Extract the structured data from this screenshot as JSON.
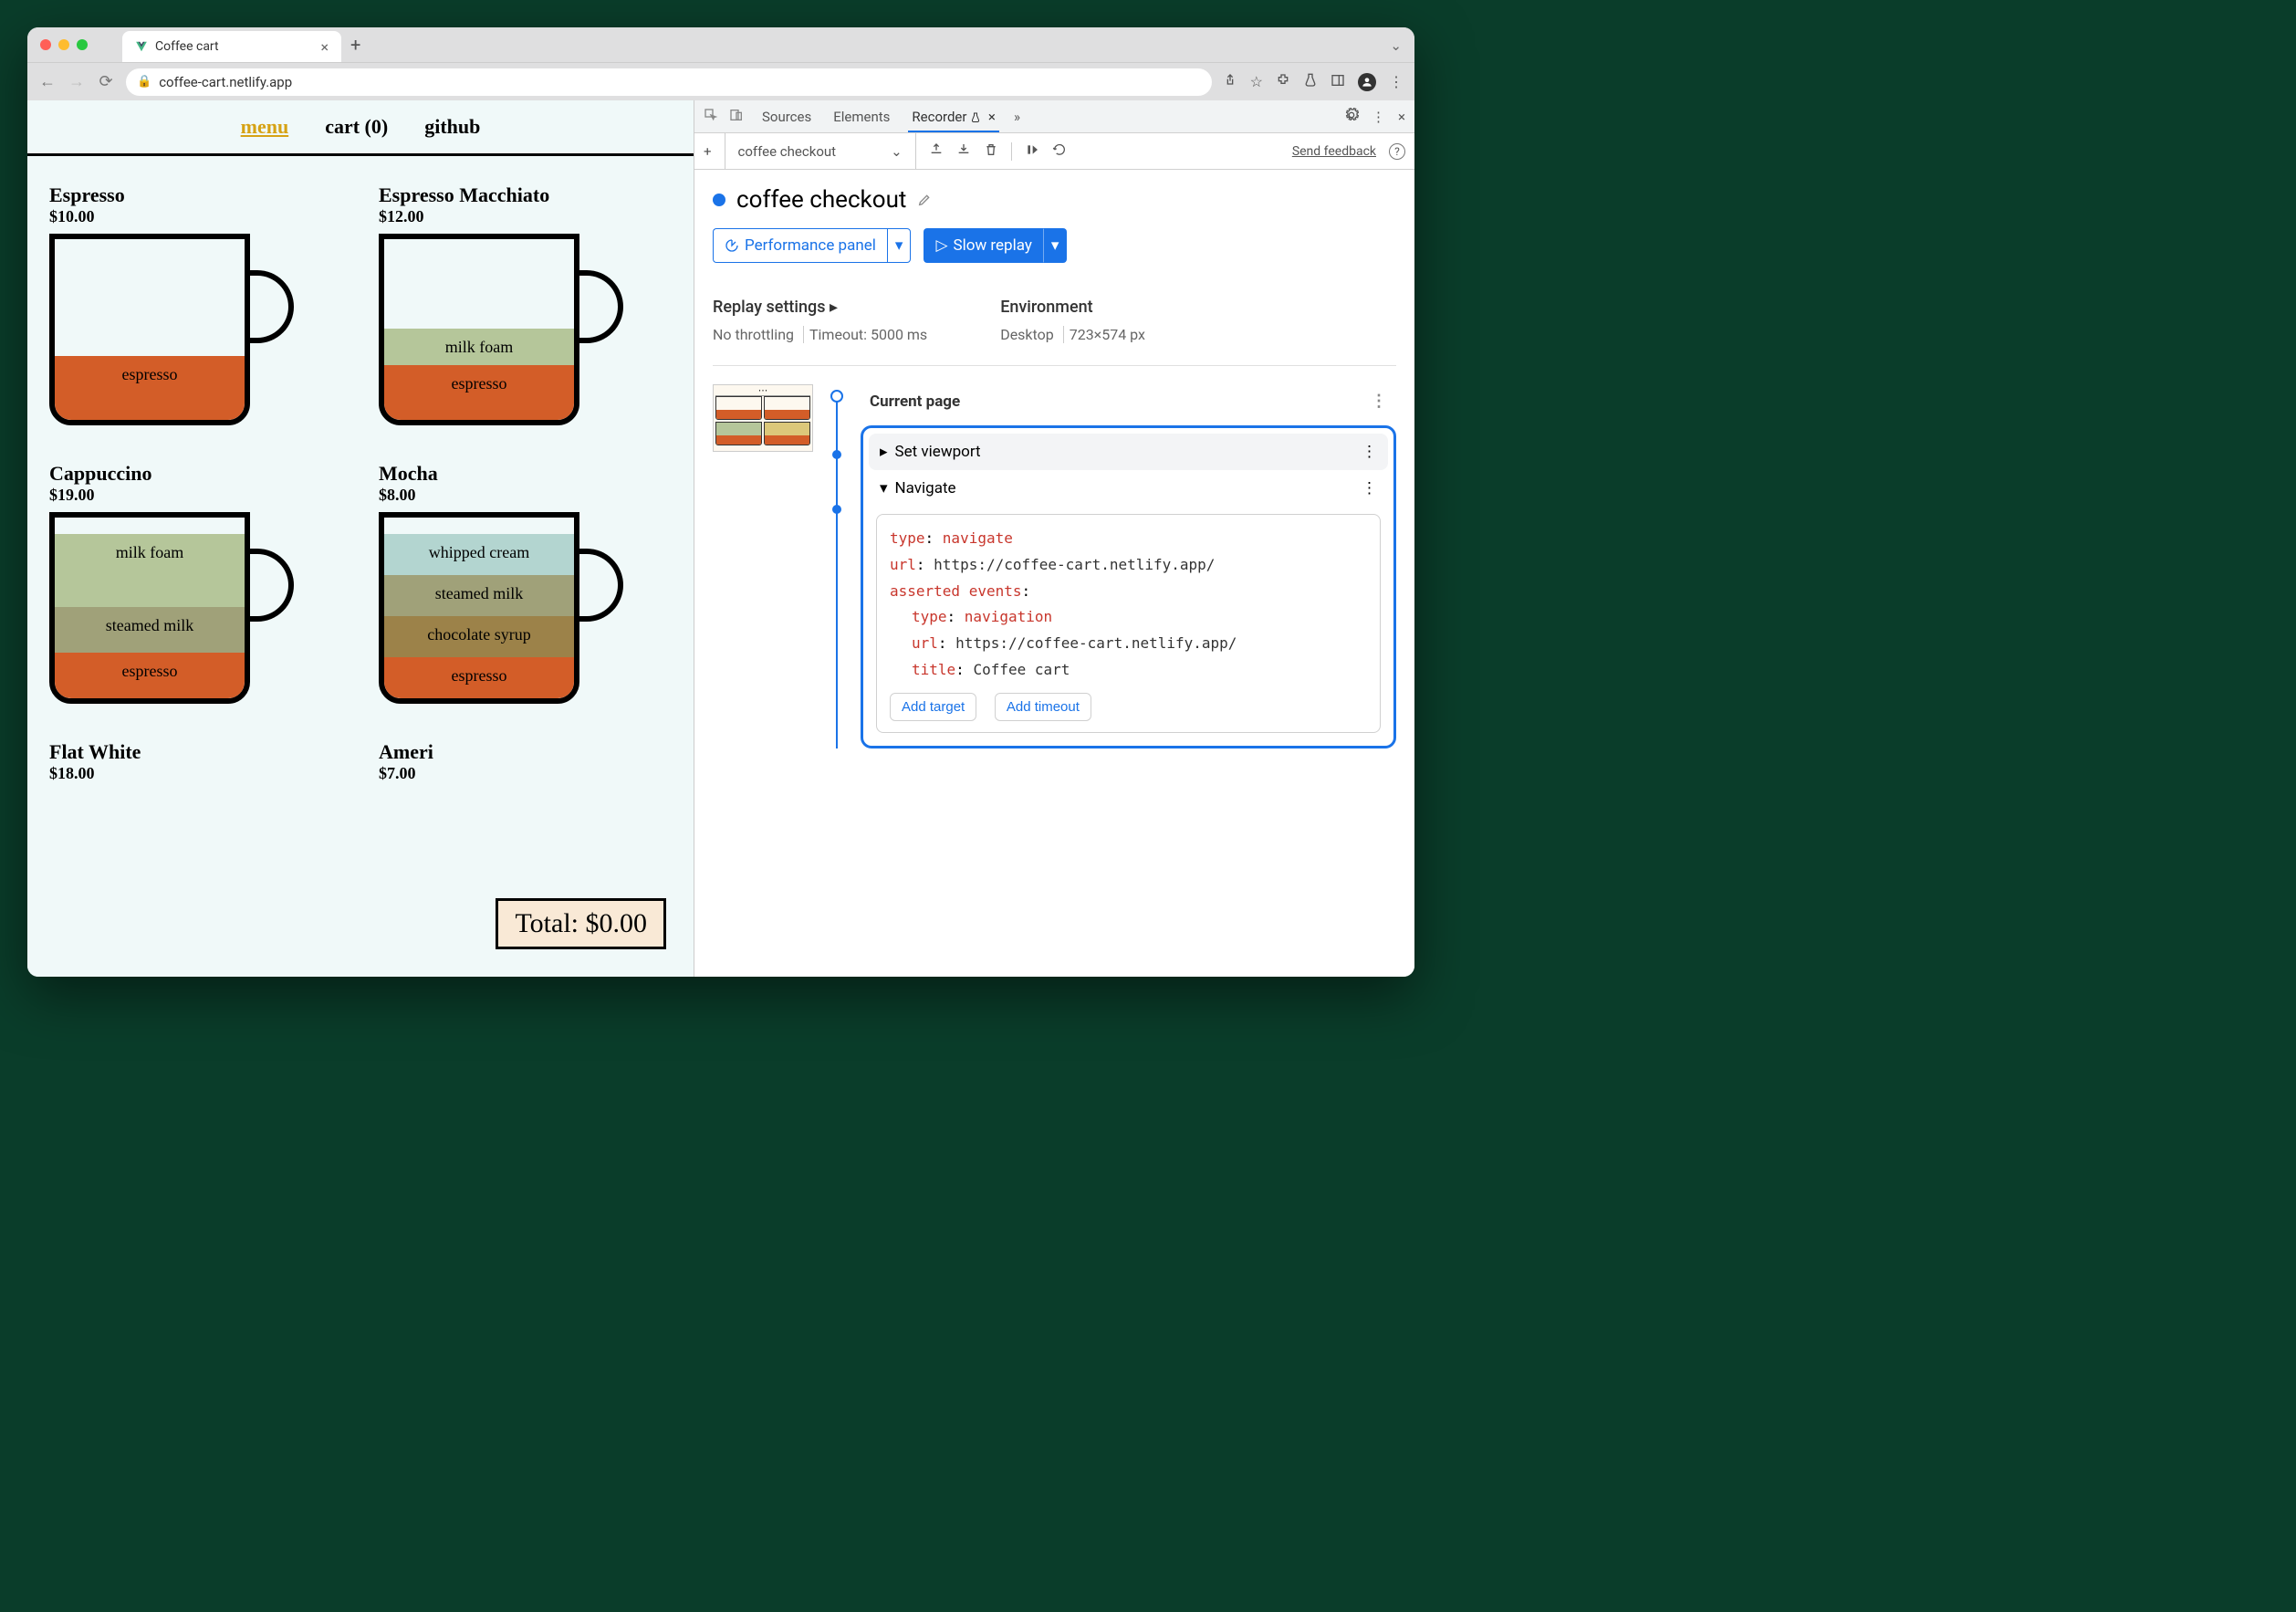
{
  "browser": {
    "tab_title": "Coffee cart",
    "url": "coffee-cart.netlify.app"
  },
  "page": {
    "nav": {
      "menu": "menu",
      "cart": "cart (0)",
      "github": "github"
    },
    "products": [
      {
        "name": "Espresso",
        "price": "$10.00"
      },
      {
        "name": "Espresso Macchiato",
        "price": "$12.00"
      },
      {
        "name": "Cappuccino",
        "price": "$19.00"
      },
      {
        "name": "Mocha",
        "price": "$8.00"
      },
      {
        "name": "Flat White",
        "price": "$18.00"
      },
      {
        "name": "Americano",
        "price": "$7.00"
      }
    ],
    "layers": {
      "espresso": "espresso",
      "milkfoam": "milk foam",
      "steamed": "steamed milk",
      "whipped": "whipped cream",
      "choc": "chocolate syrup"
    },
    "total": "Total: $0.00"
  },
  "devtools": {
    "tabs": {
      "sources": "Sources",
      "elements": "Elements",
      "recorder": "Recorder"
    },
    "toolbar": {
      "recording_name": "coffee checkout",
      "feedback": "Send feedback"
    },
    "title": "coffee checkout",
    "buttons": {
      "perf": "Performance panel",
      "replay": "Slow replay"
    },
    "settings": {
      "replay_h": "Replay settings",
      "throttling": "No throttling",
      "timeout": "Timeout: 5000 ms",
      "env_h": "Environment",
      "env_device": "Desktop",
      "env_size": "723×574 px"
    },
    "steps": {
      "current": "Current page",
      "viewport": "Set viewport",
      "navigate": "Navigate",
      "detail": {
        "type_k": "type",
        "type_v": "navigate",
        "url_k": "url",
        "url_v": "https://coffee-cart.netlify.app/",
        "ae_k": "asserted events",
        "ae_type_k": "type",
        "ae_type_v": "navigation",
        "ae_url_k": "url",
        "ae_url_v": "https://coffee-cart.netlify.app/",
        "ae_title_k": "title",
        "ae_title_v": "Coffee cart"
      },
      "add_target": "Add target",
      "add_timeout": "Add timeout"
    }
  }
}
